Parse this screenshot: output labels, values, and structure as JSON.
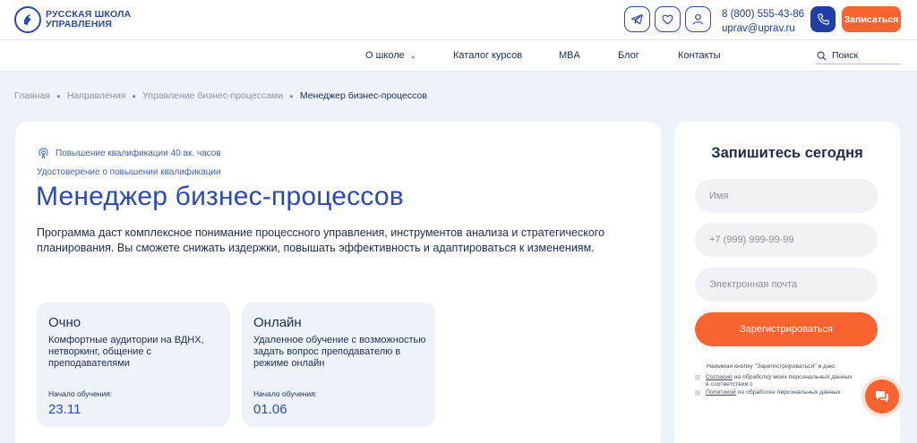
{
  "header": {
    "logo_line1": "РУССКАЯ ШКОЛА",
    "logo_line2": "УПРАВЛЕНИЯ",
    "icons": [
      "telegram-icon",
      "heart-icon",
      "user-icon",
      "phone-icon"
    ],
    "phone": "8 (800) 555-43-86",
    "email": "uprav@uprav.ru",
    "signup_label": "Записаться",
    "accent": "#f7642f",
    "brand": "#2a49a8"
  },
  "nav": {
    "items": [
      "О школе",
      "Каталог курсов",
      "MBA",
      "Блог",
      "Контакты"
    ],
    "search_label": "Поиск"
  },
  "breadcrumbs": [
    "Главная",
    "Направления",
    "Управление бизнес-процессами",
    "Менеджер бизнес-процессов"
  ],
  "course": {
    "qualification": "Повышение квалификации 40 ак. часов",
    "certificate": "Удостоверение о повышении квалификации",
    "title": "Менеджер бизнес-процессов",
    "description": "Программа даст комплексное понимание процессного управления, инструментов анализа и стратегического планирования. Вы сможете снижать издержки, повышать эффективность и адаптироваться к изменениям.",
    "formats": [
      {
        "title": "Очно",
        "text": "Комфортные аудитории на ВДНХ, нетворкинг, общение с преподавателями",
        "start_label": "Начало обучения:",
        "start_date": "23.11"
      },
      {
        "title": "Онлайн",
        "text": "Удаленное обучение с возможностью задать вопрос преподавателю в режиме онлайн",
        "start_label": "Начало обучения:",
        "start_date": "01.06"
      }
    ]
  },
  "form": {
    "title": "Запишитесь сегодня",
    "name_placeholder": "Имя",
    "phone_placeholder": "+7 (999) 999-99-99",
    "email_placeholder": "Электронная почта",
    "submit_label": "Зарегистрироваться",
    "note": "Нажимая кнопку \"Зарегистрироваться\" я даю",
    "consent1_link": "Согласие",
    "consent1_line1": " на обработку моих персональных данных",
    "consent1_line2": "в соответствии с",
    "consent2_link": "Политикой",
    "consent2_text": " по обработке персональных данных"
  }
}
